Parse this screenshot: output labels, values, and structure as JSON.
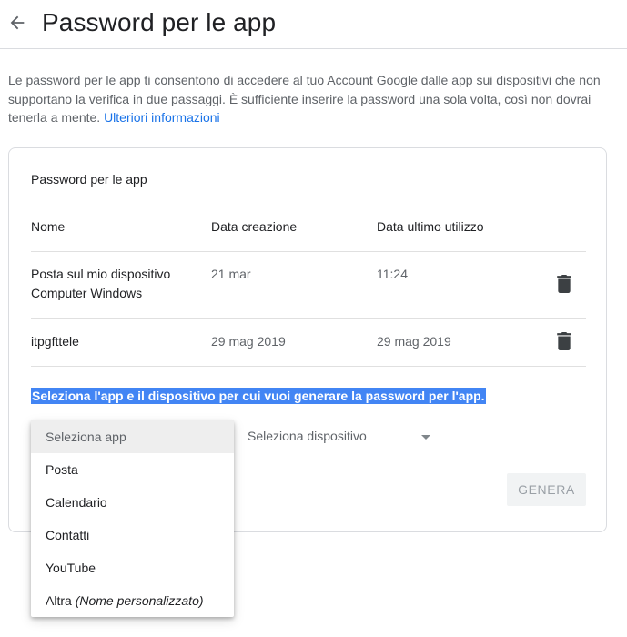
{
  "header": {
    "title": "Password per le app"
  },
  "intro": {
    "text": "Le password per le app ti consentono di accedere al tuo Account Google dalle app sui dispositivi che non supportano la verifica in due passaggi. È sufficiente inserire la password una sola volta, così non dovrai tenerla a mente.",
    "link": "Ulteriori informazioni"
  },
  "card": {
    "title": "Password per le app",
    "columns": [
      "Nome",
      "Data creazione",
      "Data ultimo utilizzo"
    ],
    "rows": [
      {
        "name": "Posta sul mio dispositivo",
        "name_line2": "Computer Windows",
        "created": "21 mar",
        "last_used": "11:24"
      },
      {
        "name": "itpgfttele",
        "name_line2": "",
        "created": "29 mag 2019",
        "last_used": "29 mag 2019"
      }
    ],
    "instruction": "Seleziona l'app e il dispositivo per cui vuoi generare la password per l'app.",
    "device_placeholder": "Seleziona dispositivo",
    "generate_label": "GENERA"
  },
  "app_dropdown": {
    "options": [
      "Seleziona app",
      "Posta",
      "Calendario",
      "Contatti",
      "YouTube",
      "Altra"
    ],
    "other_suffix": "(Nome personalizzato)"
  },
  "colors": {
    "accent": "#1a73e8",
    "highlight": "#4285f4"
  },
  "icons": {
    "back": "arrow-left-icon",
    "delete": "trash-icon",
    "caret": "caret-down-icon"
  }
}
